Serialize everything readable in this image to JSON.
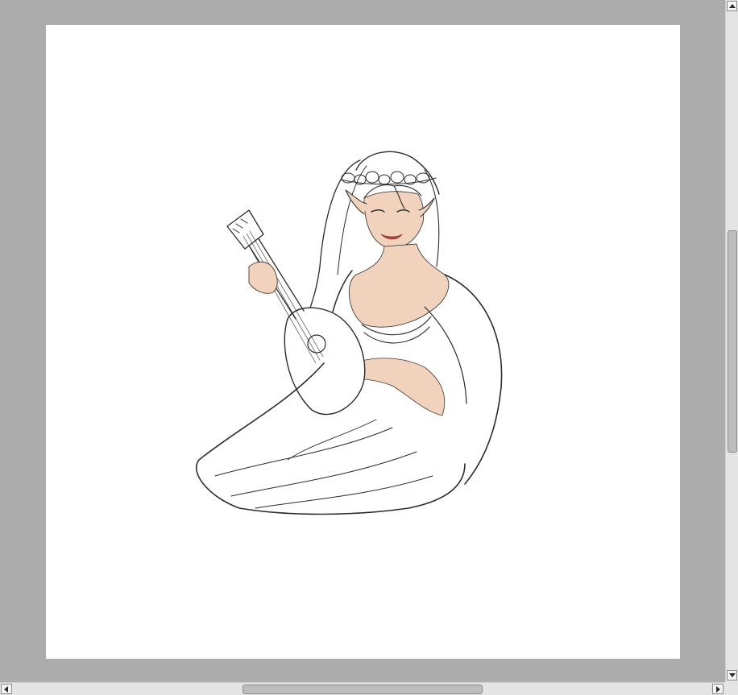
{
  "canvas": {
    "background": "#ffffff",
    "artwork": "sketch-elf-woman-playing-mandolin"
  },
  "workspace": {
    "background": "#acacac"
  },
  "colors": {
    "line": "#2b2b2b",
    "skin": "#f1d2bd",
    "skin_shadow": "#e3b79d",
    "lips": "#b0483f",
    "scrollbar_track": "#e4e4e4",
    "scrollbar_thumb": "#bdbdbd"
  },
  "icons": {
    "scroll_up": "arrow-up-icon",
    "scroll_down": "arrow-down-icon",
    "scroll_left": "arrow-left-icon",
    "scroll_right": "arrow-right-icon"
  }
}
